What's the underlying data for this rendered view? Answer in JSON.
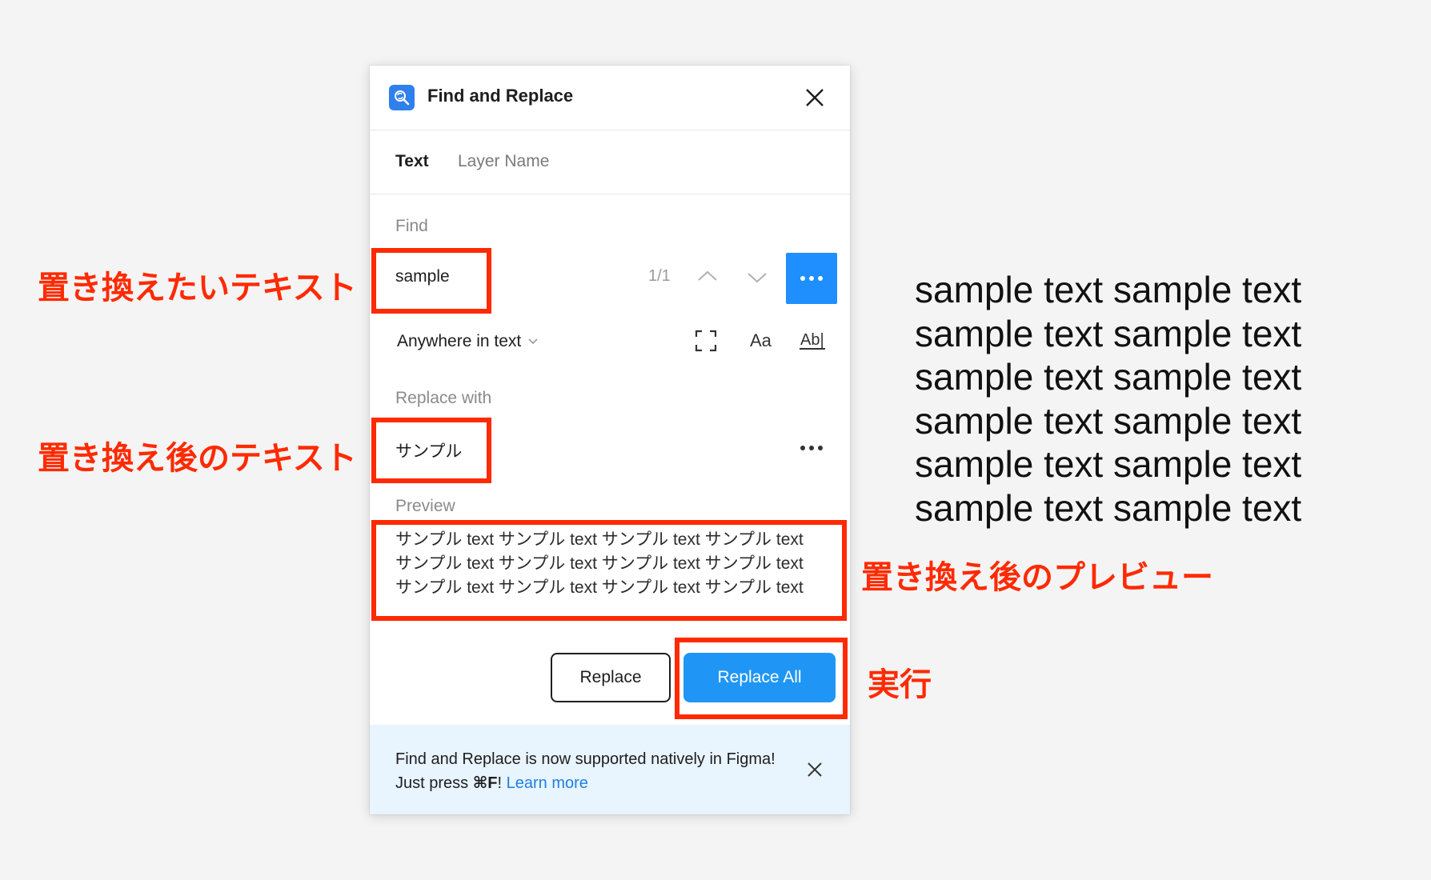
{
  "dialog": {
    "title": "Find and Replace",
    "tabs": [
      "Text",
      "Layer Name"
    ],
    "find": {
      "label": "Find",
      "value": "sample",
      "counter": "1/1"
    },
    "scope": {
      "selected": "Anywhere in text",
      "options_tools": [
        "Aa",
        "Ab|"
      ]
    },
    "replace": {
      "label": "Replace with",
      "value": "サンプル"
    },
    "preview": {
      "label": "Preview",
      "lines": [
        "サンプル text サンプル text サンプル text サンプル text",
        "サンプル text サンプル text サンプル text サンプル text",
        "サンプル text サンプル text サンプル text サンプル text"
      ]
    },
    "buttons": {
      "replace": "Replace",
      "replace_all": "Replace All"
    },
    "banner": {
      "text_before": "Find and Replace is now supported natively in Figma! Just press ",
      "shortcut": "⌘F",
      "text_after": "! ",
      "link": "Learn more"
    }
  },
  "annotations": {
    "find_text": "置き換えたいテキスト",
    "replace_text": "置き換え後のテキスト",
    "preview": "置き換え後のプレビュー",
    "execute": "実行"
  },
  "canvas_sample_lines": [
    "sample text sample text",
    "sample text sample text",
    "sample text sample text",
    "sample text sample text",
    "sample text sample text",
    "sample text sample text"
  ],
  "colors": {
    "accent_blue": "#1f96f5",
    "annotation_red": "#ff2a00",
    "banner_bg": "#e8f4fe",
    "link": "#1f7fe6"
  },
  "icons": [
    "find-replace-logo-icon",
    "close-icon",
    "chevron-up-icon",
    "chevron-down-icon",
    "more-icon",
    "fullscreen-icon",
    "match-case-icon",
    "whole-word-icon"
  ]
}
